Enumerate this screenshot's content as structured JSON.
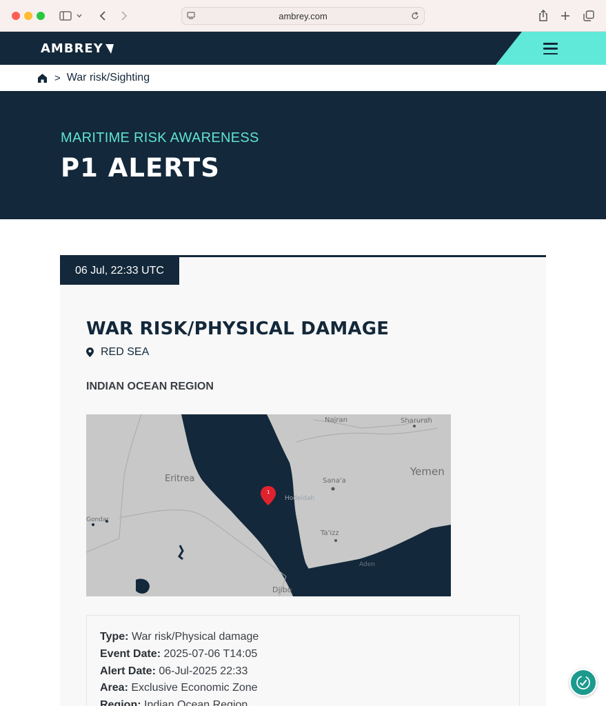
{
  "browser": {
    "url": "ambrey.com"
  },
  "site": {
    "logo_text": "AMBREY",
    "accent_color": "#60e8d8",
    "navy_color": "#13283a"
  },
  "breadcrumb": {
    "home_icon": "home-icon",
    "current": "War risk/Sighting"
  },
  "hero": {
    "kicker": "MARITIME RISK AWARENESS",
    "title": "P1 ALERTS"
  },
  "alert": {
    "date": "06 Jul, 22:33 UTC",
    "title": "WAR RISK/PHYSICAL DAMAGE",
    "location": "RED SEA",
    "region_heading": "INDIAN OCEAN REGION",
    "map": {
      "labels": {
        "najran": "Najran",
        "sharurah": "Sharurah",
        "eritrea": "Eritrea",
        "yemen": "Yemen",
        "sanaa": "Sana'a",
        "hodeidah": "Hodeidah",
        "taizz": "Ta'izz",
        "aden": "Aden",
        "djibouti": "Djibo",
        "gondar": "Gondar"
      },
      "marker_count": "1"
    },
    "details": [
      {
        "label": "Type:",
        "value": "War risk/Physical damage"
      },
      {
        "label": "Event Date:",
        "value": "2025-07-06 T14:05"
      },
      {
        "label": "Alert Date:",
        "value": "06-Jul-2025 22:33"
      },
      {
        "label": "Area:",
        "value": "Exclusive Economic Zone"
      },
      {
        "label": "Region:",
        "value": "Indian Ocean Region"
      }
    ]
  }
}
